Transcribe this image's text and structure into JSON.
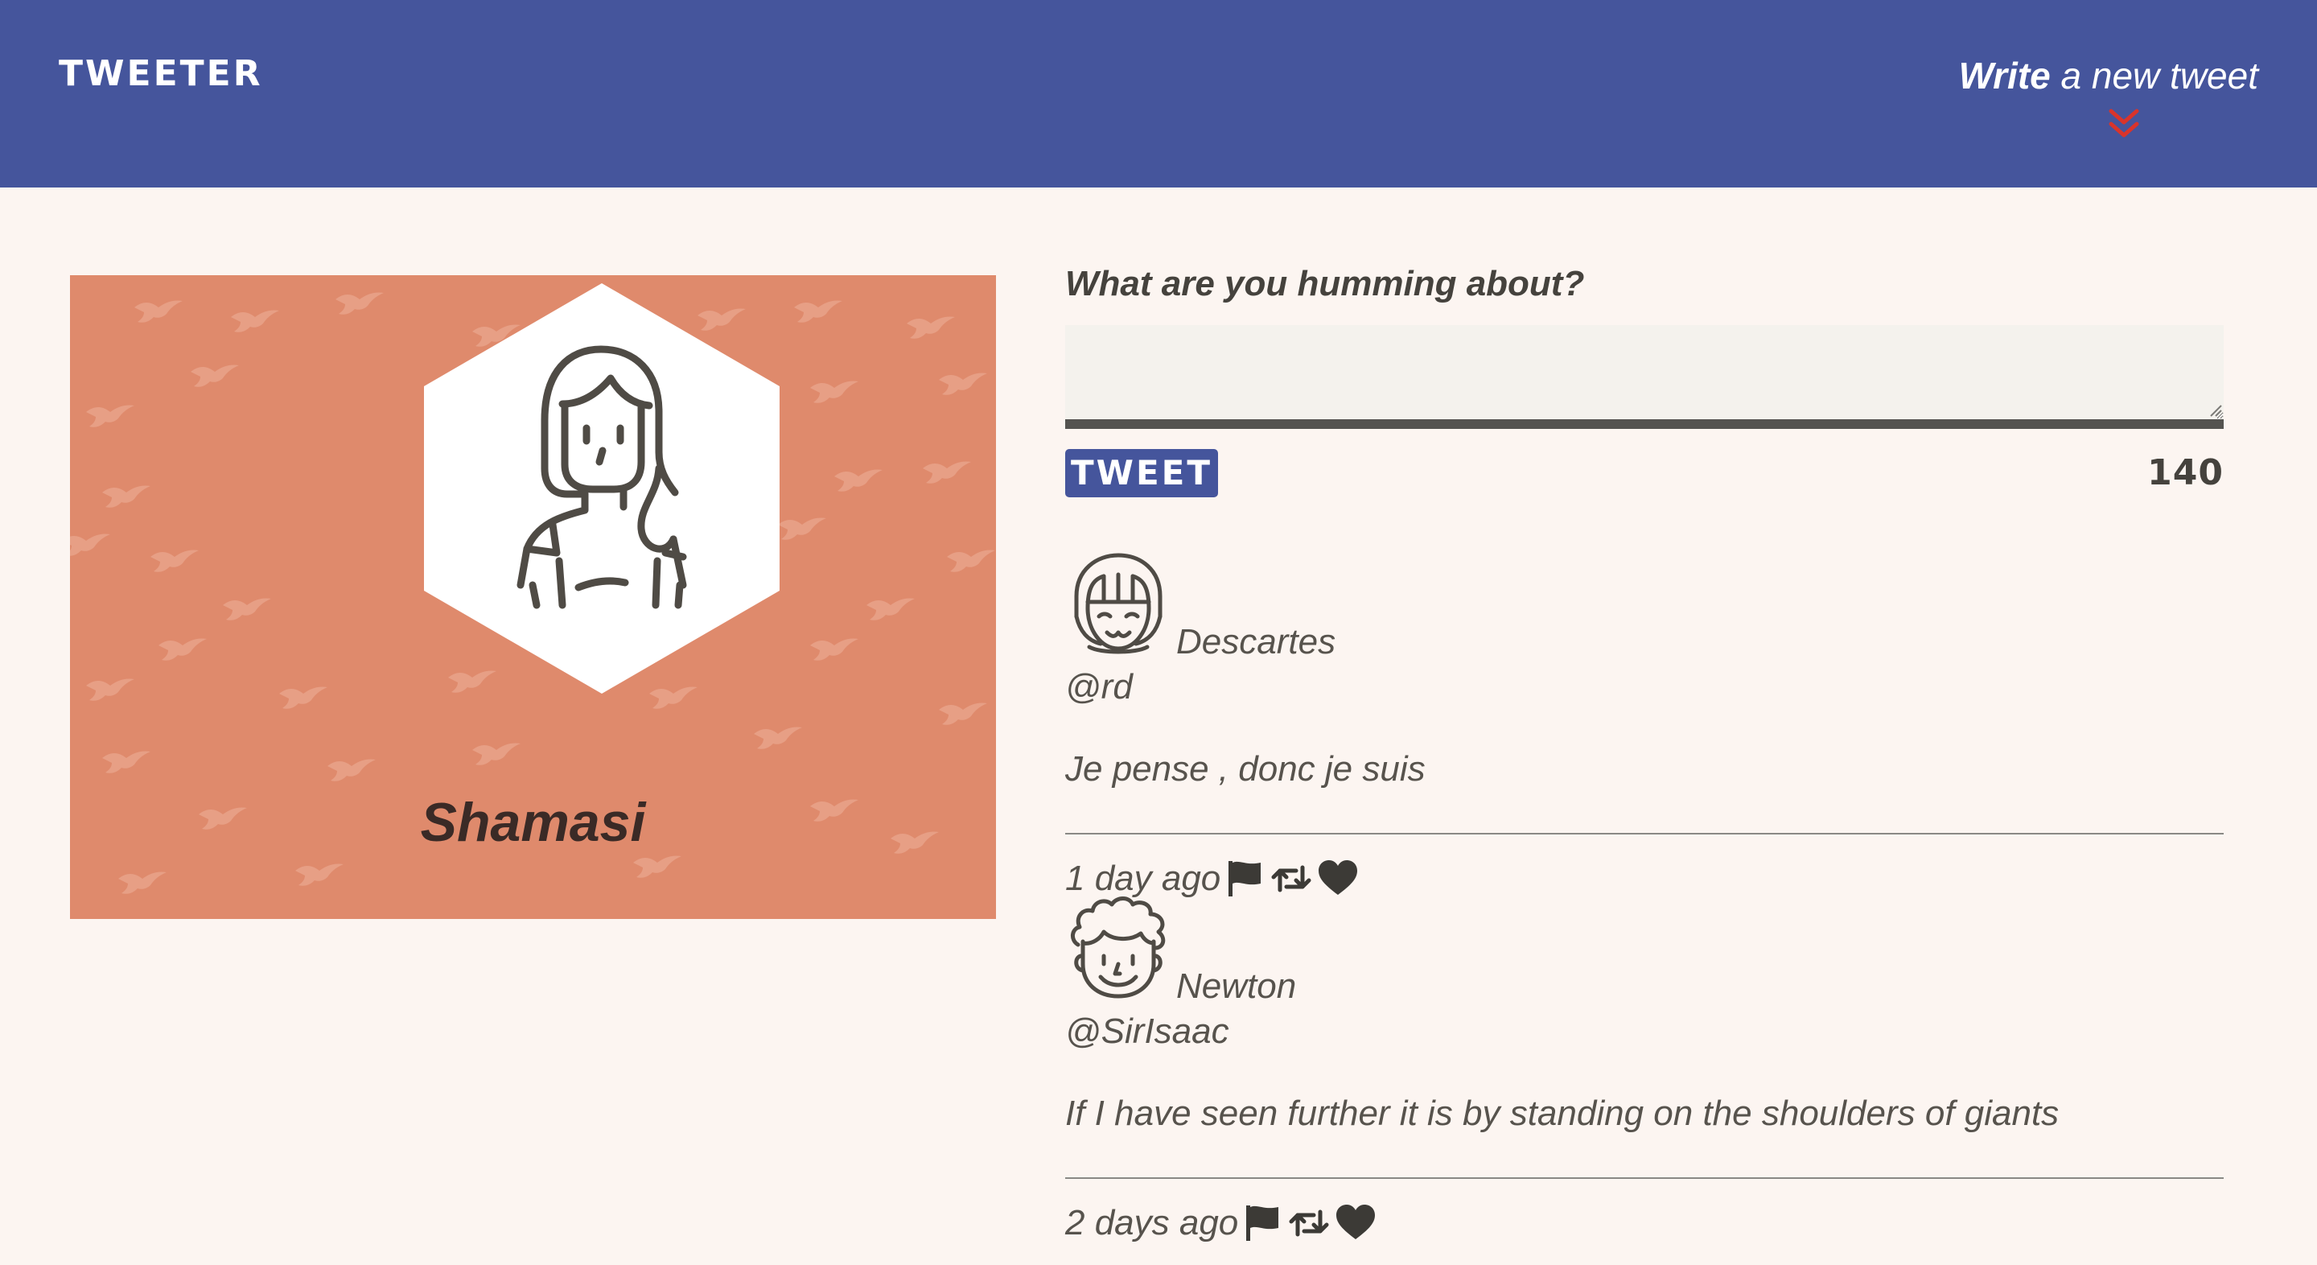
{
  "header": {
    "brand": "TWEETER",
    "compose_link_strong": "Write",
    "compose_link_rest": " a new tweet"
  },
  "profile": {
    "name": "Shamasi"
  },
  "compose": {
    "label": "What are you humming about?",
    "textarea_value": "",
    "button_label": "TWEET",
    "char_count": "140"
  },
  "tweets": [
    {
      "name": "Descartes",
      "handle": "@rd",
      "text": "Je pense , donc je suis",
      "time": "1 day ago"
    },
    {
      "name": "Newton",
      "handle": "@SirIsaac",
      "text": "If I have seen further it is by standing on the shoulders of giants",
      "time": "2 days ago"
    }
  ],
  "icons": {
    "compose_toggle": "double-chevron-down-icon",
    "flag": "flag-icon",
    "retweet": "retweet-icon",
    "like": "heart-icon"
  },
  "colors": {
    "header_bg": "#45559c",
    "page_bg": "#fcf5f1",
    "profile_card_bg": "#df8a6c",
    "chevron": "#d9342b",
    "text": "#57534d"
  }
}
